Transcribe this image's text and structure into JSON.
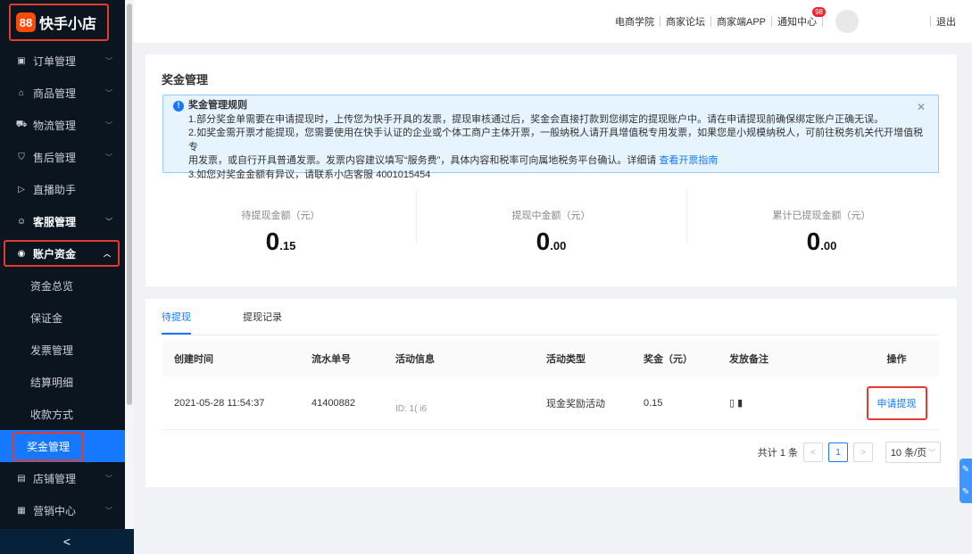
{
  "sidebar": {
    "logo_mark": "88",
    "logo_text": "快手小店",
    "items": [
      {
        "icon": "▣",
        "label": "订单管理"
      },
      {
        "icon": "⌂",
        "label": "商品管理"
      },
      {
        "icon": "⛟",
        "label": "物流管理"
      },
      {
        "icon": "⛉",
        "label": "售后管理"
      },
      {
        "icon": "▷",
        "label": "直播助手"
      },
      {
        "icon": "☺",
        "label": "客服管理"
      },
      {
        "icon": "◉",
        "label": "账户资金"
      }
    ],
    "sub_items": [
      "资金总览",
      "保证金",
      "发票管理",
      "结算明细",
      "收款方式",
      "奖金管理"
    ],
    "bottom_items": [
      {
        "icon": "▤",
        "label": "店铺管理"
      },
      {
        "icon": "▦",
        "label": "营销中心"
      }
    ],
    "collapse": "<"
  },
  "header": {
    "links": [
      "电商学院",
      "商家论坛",
      "商家端APP"
    ],
    "notice": "通知中心",
    "badge": "98",
    "logout": "退出"
  },
  "page": {
    "title": "奖金管理",
    "alert": {
      "title": "奖金管理规则",
      "line1": "1.部分奖金单需要在申请提现时，上传您为快手开具的发票，提现审核通过后，奖金会直接打款到您绑定的提现账户中。请在申请提现前确保绑定账户正确无误。",
      "line2": "2.如奖金需开票才能提现，您需要使用在快手认证的企业或个体工商户主体开票，一般纳税人请开具增值税专用发票，如果您是小规模纳税人，可前往税务机关代开增值税专",
      "line3": "用发票，或自行开具普通发票。发票内容建议填写“服务费”，具体内容和税率可向属地税务平台确认。详细请",
      "line3_link": "查看开票指南",
      "line4": "3.如您对奖金金额有异议，请联系小店客服 4001015454"
    },
    "stats": [
      {
        "label": "待提现金额（元）",
        "int": "0",
        "dec": ".15"
      },
      {
        "label": "提现中金额（元）",
        "int": "0",
        "dec": ".00"
      },
      {
        "label": "累计已提现金额（元）",
        "int": "0",
        "dec": ".00"
      }
    ]
  },
  "tabs": [
    "待提现",
    "提现记录"
  ],
  "table": {
    "headers": [
      "创建时间",
      "流水单号",
      "活动信息",
      "活动类型",
      "奖金（元）",
      "发放备注",
      "操作"
    ],
    "rows": [
      {
        "created": "2021-05-28 11:54:37",
        "serial": "41400882",
        "activity_name": ".",
        "activity_id": "ID: 1(   i6",
        "type": "现金奖励活动",
        "amount": "0.15",
        "remark": "▯ ▮",
        "action": "申请提现"
      }
    ]
  },
  "pager": {
    "total": "共计 1 条",
    "prev": "<",
    "page": "1",
    "next": ">",
    "size": "10 条/页"
  },
  "float_icons": [
    "✎",
    "✎"
  ]
}
